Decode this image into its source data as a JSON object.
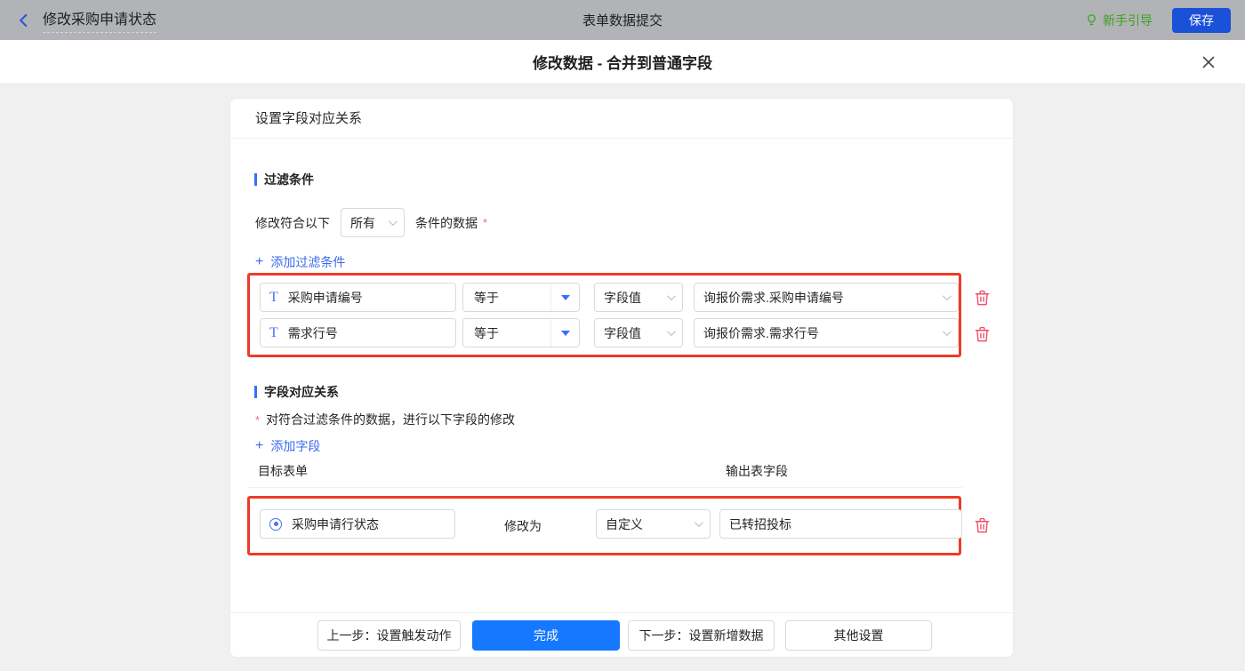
{
  "topbar": {
    "back_title": "修改采购申请状态",
    "center_title": "表单数据提交",
    "guide_label": "新手引导",
    "save_label": "保存"
  },
  "modal": {
    "title": "修改数据 - 合并到普通字段"
  },
  "icons": {
    "plus": "+",
    "text_field": "T"
  },
  "panel": {
    "header": "设置字段对应关系",
    "filter_section": {
      "title": "过滤条件",
      "prefix": "修改符合以下",
      "match_mode": "所有",
      "suffix": "条件的数据",
      "required_mark": "*",
      "add_label": "添加过滤条件",
      "rows": [
        {
          "field": "采购申请编号",
          "operator": "等于",
          "value_type": "字段值",
          "value": "询报价需求.采购申请编号"
        },
        {
          "field": "需求行号",
          "operator": "等于",
          "value_type": "字段值",
          "value": "询报价需求.需求行号"
        }
      ]
    },
    "mapping_section": {
      "title": "字段对应关系",
      "required_mark": "*",
      "desc": "对符合过滤条件的数据，进行以下字段的修改",
      "add_label": "添加字段",
      "columns": {
        "target": "目标表单",
        "output": "输出表字段"
      },
      "rows": [
        {
          "field": "采购申请行状态",
          "action_label": "修改为",
          "mode": "自定义",
          "value": "已转招投标"
        }
      ]
    },
    "footer": {
      "prev_label": "上一步：设置触发动作",
      "done_label": "完成",
      "next_label": "下一步：设置新增数据",
      "other_label": "其他设置"
    }
  },
  "colors": {
    "accent_blue": "#3370ff",
    "link_blue": "#3e6bf0",
    "highlight_red": "#ee3b28",
    "danger_pink": "#f0506a",
    "save_blue": "#1b50d8",
    "done_blue": "#1677ff",
    "guide_green": "#3ba220"
  }
}
